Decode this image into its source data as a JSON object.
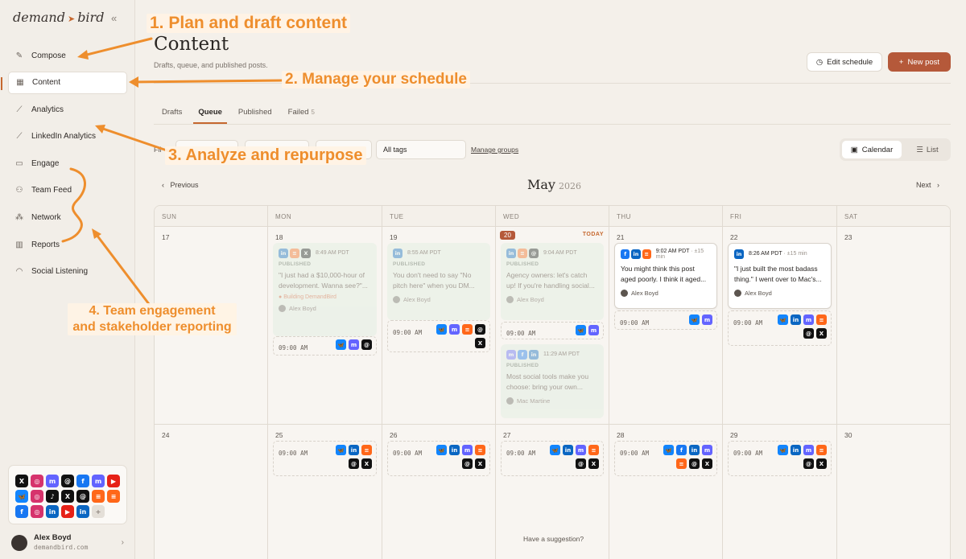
{
  "sidebar": {
    "logo_left": "demand",
    "logo_right": "bird",
    "collapse_icon": "«",
    "items": [
      {
        "label": "Compose",
        "icon": "✎"
      },
      {
        "label": "Content",
        "icon": "▦"
      },
      {
        "label": "Analytics",
        "icon": "⟋"
      },
      {
        "label": "LinkedIn Analytics",
        "icon": "⟋"
      },
      {
        "label": "Engage",
        "icon": "▭"
      },
      {
        "label": "Team Feed",
        "icon": "⚇"
      },
      {
        "label": "Network",
        "icon": "⁂"
      },
      {
        "label": "Reports",
        "icon": "▥"
      },
      {
        "label": "Social Listening",
        "icon": "◠"
      }
    ],
    "active_index": 1,
    "social_accounts": [
      {
        "n": "x",
        "c": "#111111",
        "g": "X"
      },
      {
        "n": "instagram",
        "c": "#d6336c",
        "g": "◎"
      },
      {
        "n": "mastodon",
        "c": "#6364ff",
        "g": "m"
      },
      {
        "n": "threads",
        "c": "#111111",
        "g": "@"
      },
      {
        "n": "facebook",
        "c": "#1877f2",
        "g": "f"
      },
      {
        "n": "mastodon",
        "c": "#6364ff",
        "g": "m"
      },
      {
        "n": "youtube",
        "c": "#e62117",
        "g": "▶"
      },
      {
        "n": "bluesky",
        "c": "#1185fe",
        "g": "🦋"
      },
      {
        "n": "instagram",
        "c": "#d6336c",
        "g": "◎"
      },
      {
        "n": "tiktok",
        "c": "#111111",
        "g": "♪"
      },
      {
        "n": "x",
        "c": "#111111",
        "g": "X"
      },
      {
        "n": "threads",
        "c": "#111111",
        "g": "@"
      },
      {
        "n": "substack",
        "c": "#ff6719",
        "g": "≡"
      },
      {
        "n": "substack",
        "c": "#ff6719",
        "g": "≡"
      },
      {
        "n": "facebook",
        "c": "#1877f2",
        "g": "f"
      },
      {
        "n": "instagram",
        "c": "#d6336c",
        "g": "◎"
      },
      {
        "n": "linkedin",
        "c": "#0a66c2",
        "g": "in"
      },
      {
        "n": "youtube",
        "c": "#e62117",
        "g": "▶"
      },
      {
        "n": "linkedin",
        "c": "#0a66c2",
        "g": "in"
      }
    ],
    "add_account": "+",
    "user": {
      "name": "Alex Boyd",
      "handle": "demandbird.com"
    }
  },
  "header": {
    "title": "Content",
    "subtitle": "Drafts, queue, and published posts.",
    "edit_schedule": "Edit schedule",
    "new_post": "New post"
  },
  "tabs": [
    {
      "label": "Drafts"
    },
    {
      "label": "Queue",
      "active": true
    },
    {
      "label": "Published"
    },
    {
      "label": "Failed",
      "count": "5"
    }
  ],
  "filters": {
    "label": "Fil",
    "tags": "All tags",
    "manage_groups": "Manage groups",
    "view_calendar": "Calendar",
    "view_list": "List"
  },
  "calendar": {
    "prev": "Previous",
    "next": "Next",
    "month": "May",
    "year": "2026",
    "weekdays": [
      "SUN",
      "MON",
      "TUE",
      "WED",
      "THU",
      "FRI",
      "SAT"
    ],
    "week1_days": [
      "17",
      "18",
      "19",
      "20",
      "21",
      "22",
      "23"
    ],
    "week2_days": [
      "24",
      "25",
      "26",
      "27",
      "28",
      "29",
      "30"
    ],
    "today_label": "TODAY",
    "slot_time": "09:00 AM",
    "posts": {
      "mon": {
        "time": "8:49 AM PDT",
        "status": "PUBLISHED",
        "text": "\"I just had a $10,000-hour of development. Wanna see?\"...",
        "tag": "Building DemandBird",
        "author": "Alex Boyd"
      },
      "tue": {
        "time": "8:55 AM PDT",
        "status": "PUBLISHED",
        "text": "You don't need to say \"No pitch here\" when you DM...",
        "author": "Alex Boyd"
      },
      "wed1": {
        "time": "9:04 AM PDT",
        "status": "PUBLISHED",
        "text": "Agency owners: let's catch up! If you're handling social...",
        "author": "Alex Boyd"
      },
      "wed2": {
        "time": "11:29 AM PDT",
        "status": "PUBLISHED",
        "text": "Most social tools make you choose: bring your own...",
        "author": "Mac Martine"
      },
      "thu": {
        "time": "9:02 AM PDT",
        "sub": "· ±15 min",
        "text": "You might think this post aged poorly. I think it aged...",
        "author": "Alex Boyd"
      },
      "fri": {
        "time": "8:26 AM PDT",
        "sub": "· ±15 min",
        "text": "\"I just built the most badass thing.\" I went over to Mac's...",
        "author": "Alex Boyd"
      }
    }
  },
  "footer": {
    "suggest": "Have a suggestion?"
  },
  "annotations": {
    "a1": "1. Plan and draft content",
    "a2": "2. Manage your schedule",
    "a3": "3. Analyze and repurpose",
    "a4_line1": "4. Team engagement",
    "a4_line2": "and stakeholder reporting"
  },
  "colors": {
    "accent": "#b5593a",
    "annotation": "#ee8e2d"
  }
}
